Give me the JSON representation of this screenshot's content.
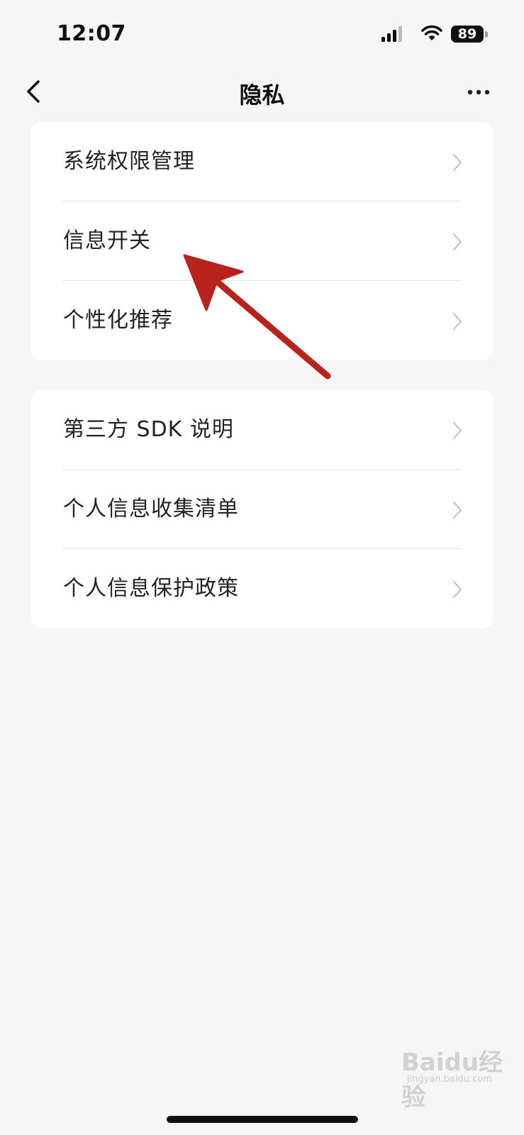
{
  "status_bar": {
    "time": "12:07",
    "battery_level": "89",
    "signal_icon": "cellular-signal-icon",
    "wifi_icon": "wifi-icon"
  },
  "nav": {
    "title": "隐私",
    "back_icon": "chevron-left-icon",
    "more_icon": "more-dots-icon"
  },
  "groups": [
    {
      "items": [
        {
          "label": "系统权限管理"
        },
        {
          "label": "信息开关"
        },
        {
          "label": "个性化推荐"
        }
      ]
    },
    {
      "items": [
        {
          "label": "第三方 SDK 说明"
        },
        {
          "label": "个人信息收集清单"
        },
        {
          "label": "个人信息保护政策"
        }
      ]
    }
  ],
  "annotation": {
    "color": "#b8231b",
    "points_to": "信息开关"
  },
  "watermark": {
    "main": "Baidu经验",
    "sub": "jingyan.baidu.com"
  },
  "colors": {
    "background": "#f6f6f6",
    "card": "#ffffff",
    "divider": "#e3e3e3",
    "chevron": "#bdbdbd",
    "text": "#222222"
  }
}
